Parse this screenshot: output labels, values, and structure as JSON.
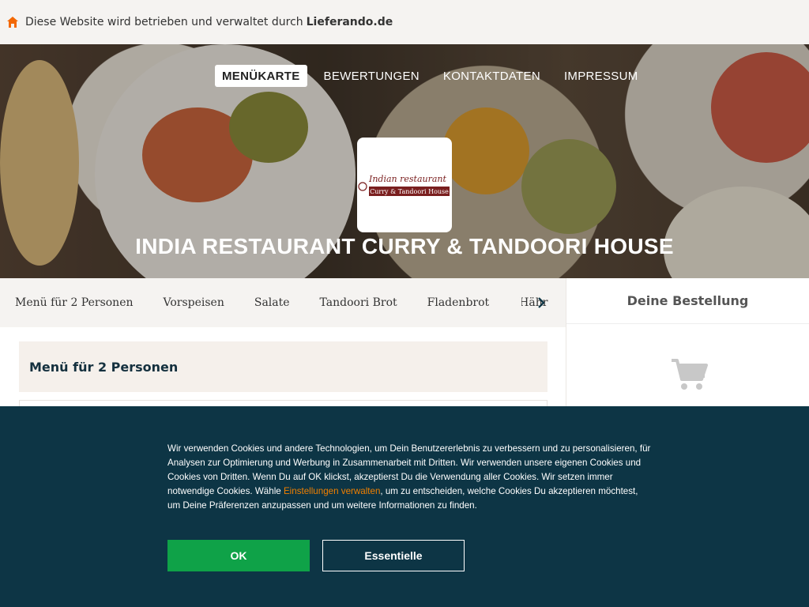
{
  "topbar": {
    "text": "Diese Website wird betrieben und verwaltet durch",
    "brand": "Lieferando.de",
    "icon": "house-icon",
    "accent": "#f36805"
  },
  "nav": {
    "items": [
      "MENÜKARTE",
      "BEWERTUNGEN",
      "KONTAKTDATEN",
      "IMPRESSUM"
    ],
    "active_index": 0
  },
  "logo": {
    "line1": "Indian restaurant",
    "line2": "Curry & Tandoori House"
  },
  "restaurant_name": "INDIA RESTAURANT CURRY & TANDOORI HOUSE",
  "categories": [
    "Menü für 2 Personen",
    "Vorspeisen",
    "Salate",
    "Tandoori Brot",
    "Fladenbrot",
    "Hähr"
  ],
  "section": {
    "title": "Menü für 2 Personen"
  },
  "basket": {
    "title": "Deine Bestellung",
    "icon": "cart-icon"
  },
  "cookie": {
    "text_before": "Wir verwenden Cookies und andere Technologien, um Dein Benutzererlebnis zu verbessern und zu personalisieren, für Analysen zur Optimierung und Werbung in Zusammenarbeit mit Dritten. Wir verwenden unsere eigenen Cookies und Cookies von Dritten. Wenn Du auf OK klickst, akzeptierst Du die Verwendung aller Cookies. Wir setzen immer notwendige Cookies. Wähle ",
    "link_text": "Einstellungen verwalten",
    "text_after": ", um zu entscheiden, welche Cookies Du akzeptieren möchtest, um Deine Präferenzen anzupassen und um weitere Informationen zu finden.",
    "ok_label": "OK",
    "essential_label": "Essentielle",
    "bg_color": "#0d3545",
    "ok_color": "#0fa248",
    "link_color": "#f28000"
  }
}
